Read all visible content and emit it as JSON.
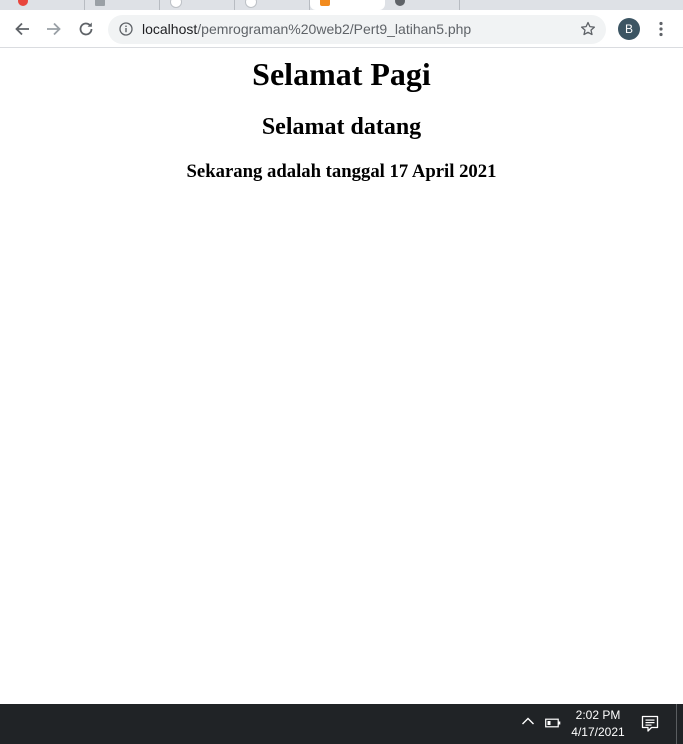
{
  "browser": {
    "url_host": "localhost",
    "url_path": "/pemrograman%20web2/Pert9_latihan5.php",
    "profile_initial": "B"
  },
  "page": {
    "heading1": "Selamat Pagi",
    "heading2": "Selamat datang",
    "heading3": "Sekarang adalah tanggal 17 April 2021"
  },
  "taskbar": {
    "time": "2:02 PM",
    "date": "4/17/2021"
  },
  "colors": {
    "tabstrip": "#dee1e6",
    "omnibox": "#f1f3f4",
    "avatar": "#3c5563",
    "taskbar": "#202326",
    "active_tab_favicon": "#f28b1e"
  }
}
